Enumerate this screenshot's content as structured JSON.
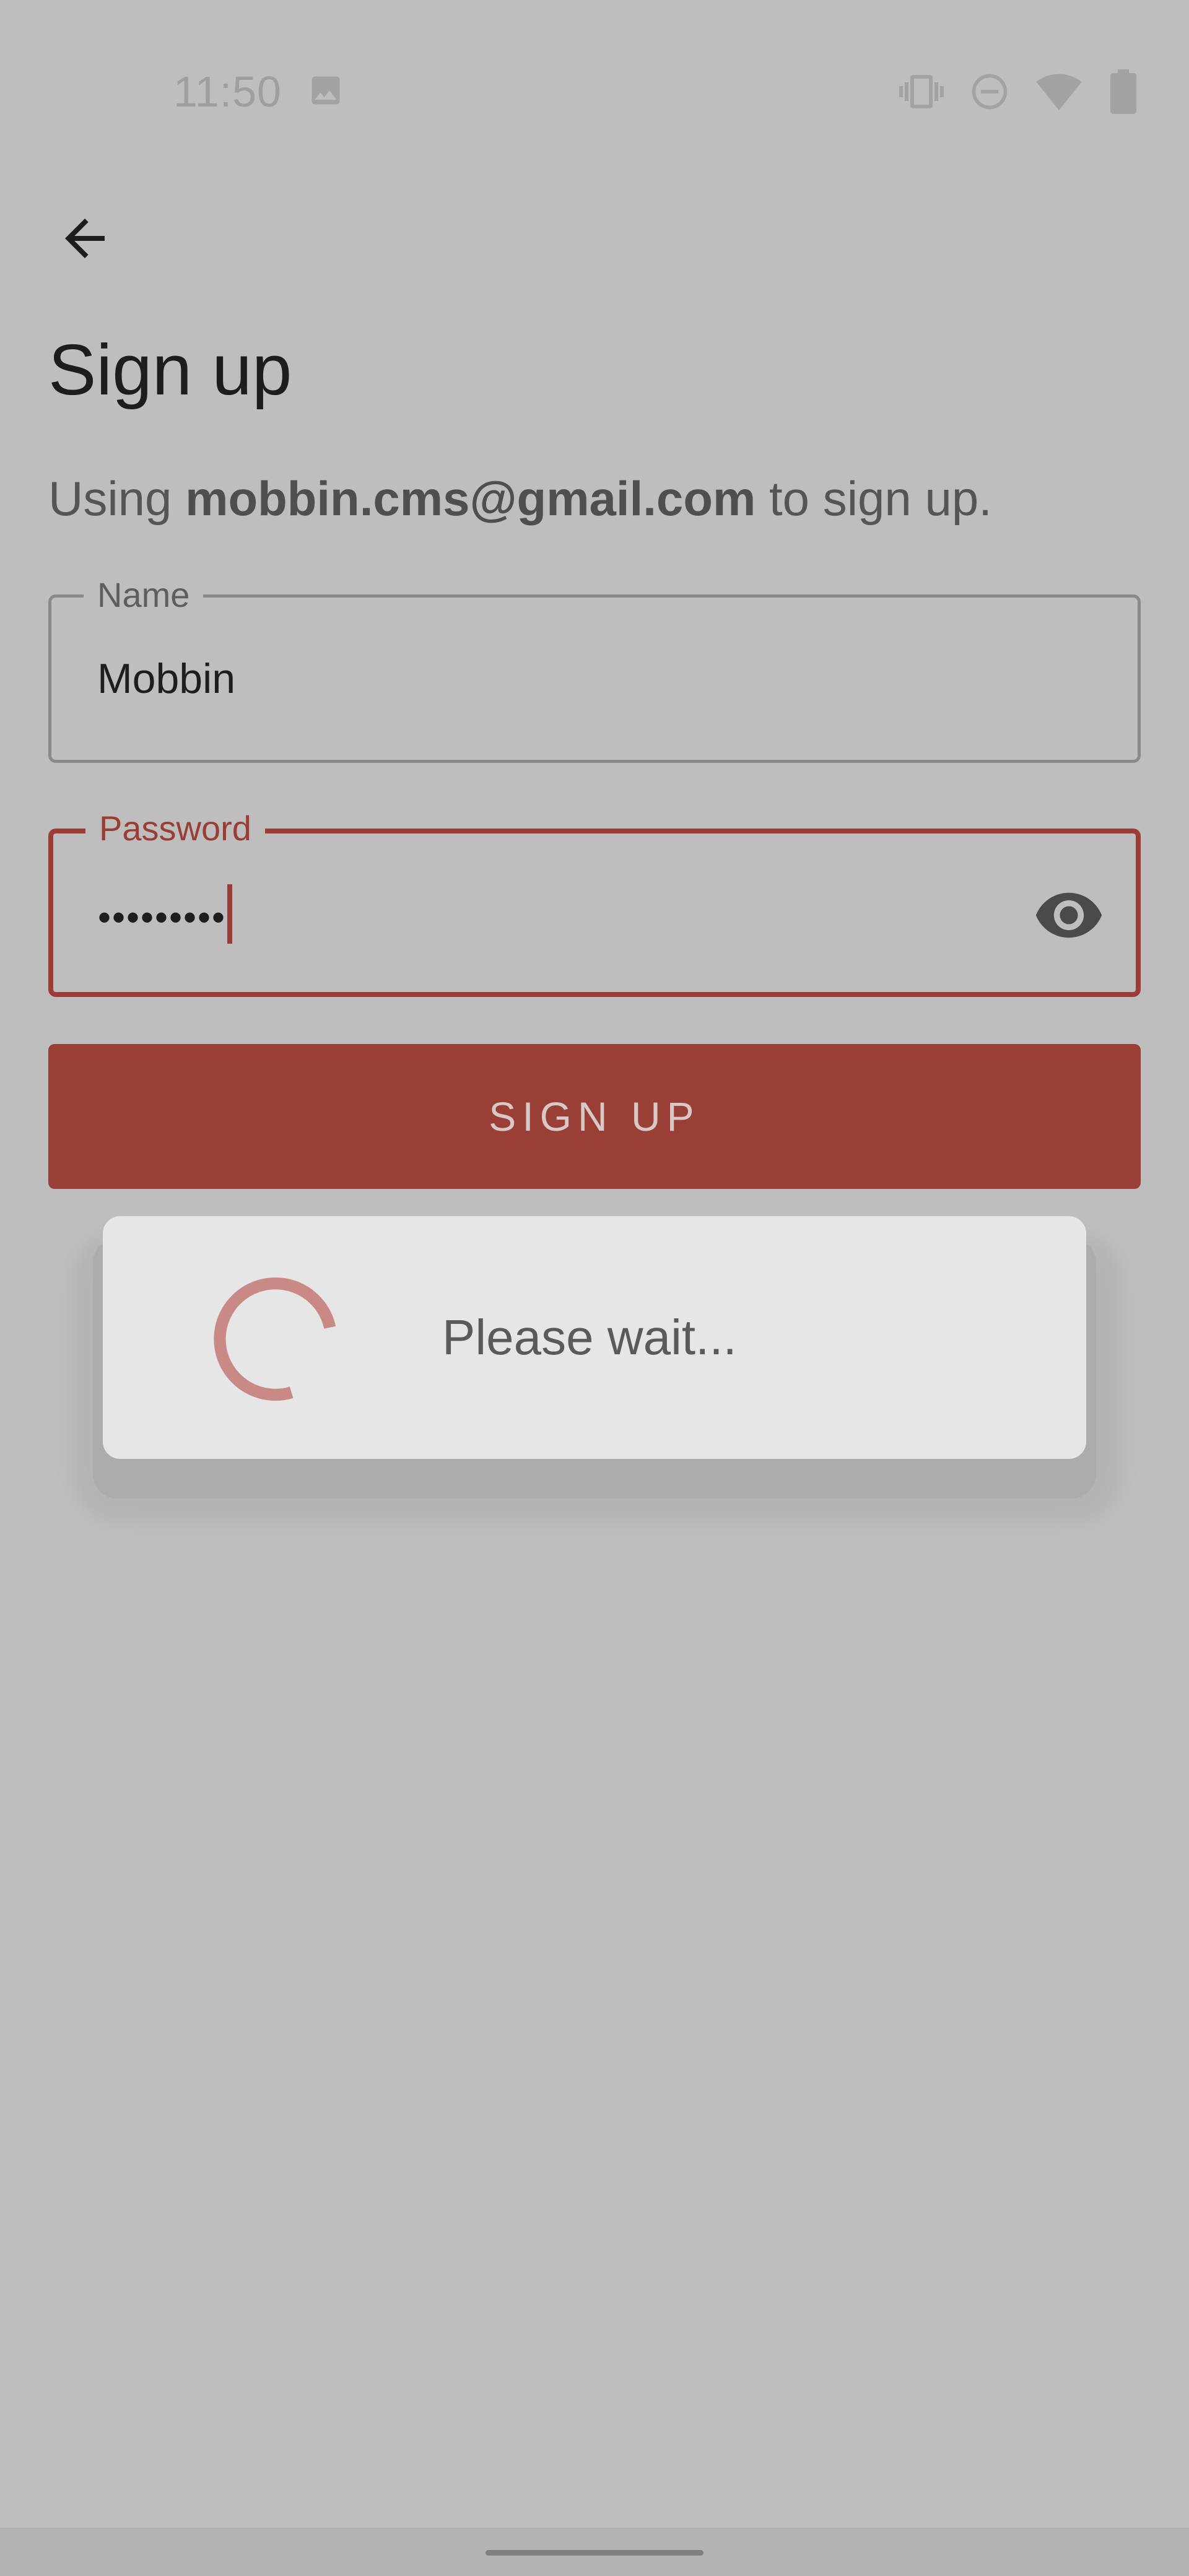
{
  "status_bar": {
    "time": "11:50",
    "icons": [
      "gallery-icon",
      "vibrate-icon",
      "do-not-disturb-icon",
      "wifi-icon",
      "battery-icon"
    ]
  },
  "header": {
    "back_icon": "arrow-back-icon",
    "title": "Sign up"
  },
  "subtitle": {
    "prefix": "Using ",
    "email": "mobbin.cms@gmail.com",
    "suffix": " to sign up."
  },
  "form": {
    "name": {
      "label": "Name",
      "value": "Mobbin"
    },
    "password": {
      "label": "Password",
      "value": "•••••••••",
      "toggle_icon": "eye-icon"
    },
    "submit_label": "SIGN UP"
  },
  "dialog": {
    "message": "Please wait..."
  },
  "colors": {
    "accent": "#9a3f36",
    "background": "#bebebe",
    "dialog": "#e6e6e6",
    "spinner": "#c98a86"
  }
}
